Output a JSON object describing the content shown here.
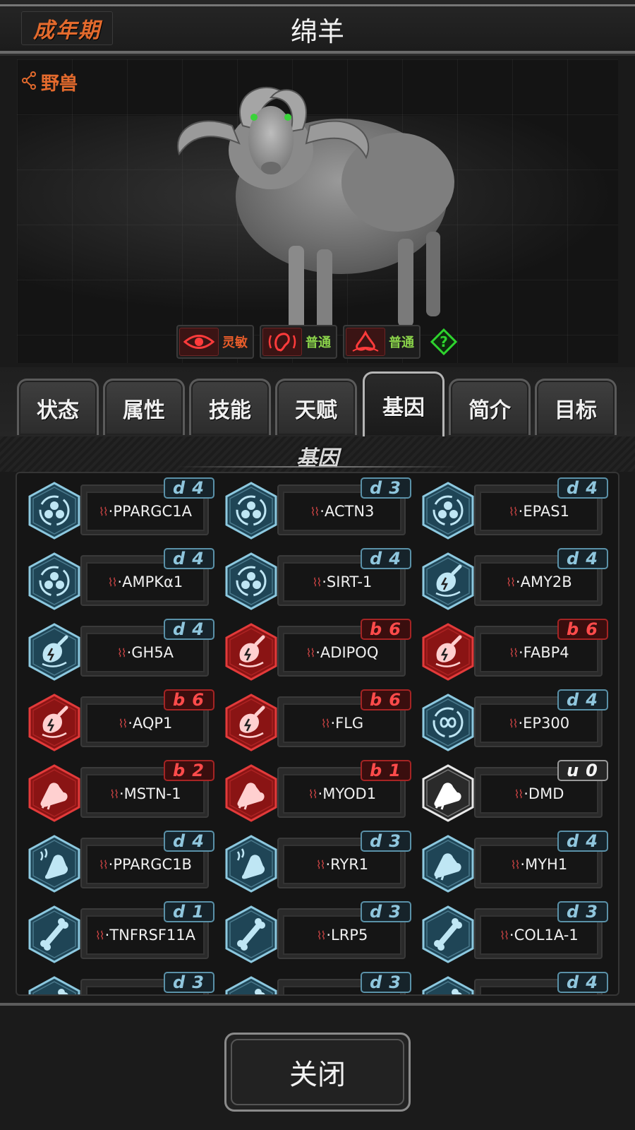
{
  "header": {
    "stage": "成年期",
    "title": "绵羊"
  },
  "portrait": {
    "category_link": "野兽",
    "category_icon": "share-icon"
  },
  "traits": [
    {
      "icon": "eye-icon",
      "label": "灵敏",
      "color": "#e65c2a"
    },
    {
      "icon": "ear-icon",
      "label": "普通",
      "color": "#8ad34a"
    },
    {
      "icon": "nose-icon",
      "label": "普通",
      "color": "#8ad34a"
    }
  ],
  "tabs": [
    {
      "label": "状态"
    },
    {
      "label": "属性"
    },
    {
      "label": "技能"
    },
    {
      "label": "天赋"
    },
    {
      "label": "基因",
      "active": true
    },
    {
      "label": "简介"
    },
    {
      "label": "目标"
    }
  ],
  "panel": {
    "title": "基因"
  },
  "genes": [
    {
      "name": "·PPARGC1A",
      "badge": "d4",
      "type": "d",
      "icon": "metabolism-icon",
      "color": "blue"
    },
    {
      "name": "·ACTN3",
      "badge": "d3",
      "type": "d",
      "icon": "metabolism-icon",
      "color": "blue"
    },
    {
      "name": "·EPAS1",
      "badge": "d4",
      "type": "d",
      "icon": "metabolism-icon",
      "color": "blue"
    },
    {
      "name": "·AMPKα1",
      "badge": "d4",
      "type": "d",
      "icon": "metabolism-icon",
      "color": "blue"
    },
    {
      "name": "·SIRT-1",
      "badge": "d4",
      "type": "d",
      "icon": "metabolism-icon",
      "color": "blue"
    },
    {
      "name": "·AMY2B",
      "badge": "d4",
      "type": "d",
      "icon": "meat-energy-icon",
      "color": "blue"
    },
    {
      "name": "·GH5A",
      "badge": "d4",
      "type": "d",
      "icon": "meat-energy-icon",
      "color": "blue"
    },
    {
      "name": "·ADIPOQ",
      "badge": "b6",
      "type": "b",
      "icon": "meat-energy-icon",
      "color": "red"
    },
    {
      "name": "·FABP4",
      "badge": "b6",
      "type": "b",
      "icon": "meat-energy-icon",
      "color": "red"
    },
    {
      "name": "·AQP1",
      "badge": "b6",
      "type": "b",
      "icon": "meat-energy-icon",
      "color": "red"
    },
    {
      "name": "·FLG",
      "badge": "b6",
      "type": "b",
      "icon": "meat-energy-icon",
      "color": "red"
    },
    {
      "name": "·EP300",
      "badge": "d4",
      "type": "d",
      "icon": "cycle-icon",
      "color": "blue"
    },
    {
      "name": "·MSTN-1",
      "badge": "b2",
      "type": "b",
      "icon": "muscle-arm-icon",
      "color": "red"
    },
    {
      "name": "·MYOD1",
      "badge": "b1",
      "type": "b",
      "icon": "muscle-arm-icon",
      "color": "red"
    },
    {
      "name": "·DMD",
      "badge": "u0",
      "type": "u",
      "icon": "muscle-arm-icon",
      "color": "white"
    },
    {
      "name": "·PPARGC1B",
      "badge": "d4",
      "type": "d",
      "icon": "muscle-heat-icon",
      "color": "blue"
    },
    {
      "name": "·RYR1",
      "badge": "d3",
      "type": "d",
      "icon": "muscle-heat-icon",
      "color": "blue"
    },
    {
      "name": "·MYH1",
      "badge": "d4",
      "type": "d",
      "icon": "muscle-arm-icon",
      "color": "blue"
    },
    {
      "name": "·TNFRSF11A",
      "badge": "d1",
      "type": "d",
      "icon": "bone-icon",
      "color": "blue"
    },
    {
      "name": "·LRP5",
      "badge": "d3",
      "type": "d",
      "icon": "bone-icon",
      "color": "blue"
    },
    {
      "name": "·COL1A-1",
      "badge": "d3",
      "type": "d",
      "icon": "bone-icon",
      "color": "blue"
    },
    {
      "name": "",
      "badge": "d3",
      "type": "d",
      "icon": "bone-icon",
      "color": "blue"
    },
    {
      "name": "",
      "badge": "d3",
      "type": "d",
      "icon": "bone-icon",
      "color": "blue"
    },
    {
      "name": "",
      "badge": "d4",
      "type": "d",
      "icon": "bone-icon",
      "color": "blue"
    }
  ],
  "footer": {
    "close_label": "关闭"
  },
  "colors": {
    "accent": "#e36a2d",
    "blue": "#8fc6dd",
    "red": "#ff4b4b"
  }
}
